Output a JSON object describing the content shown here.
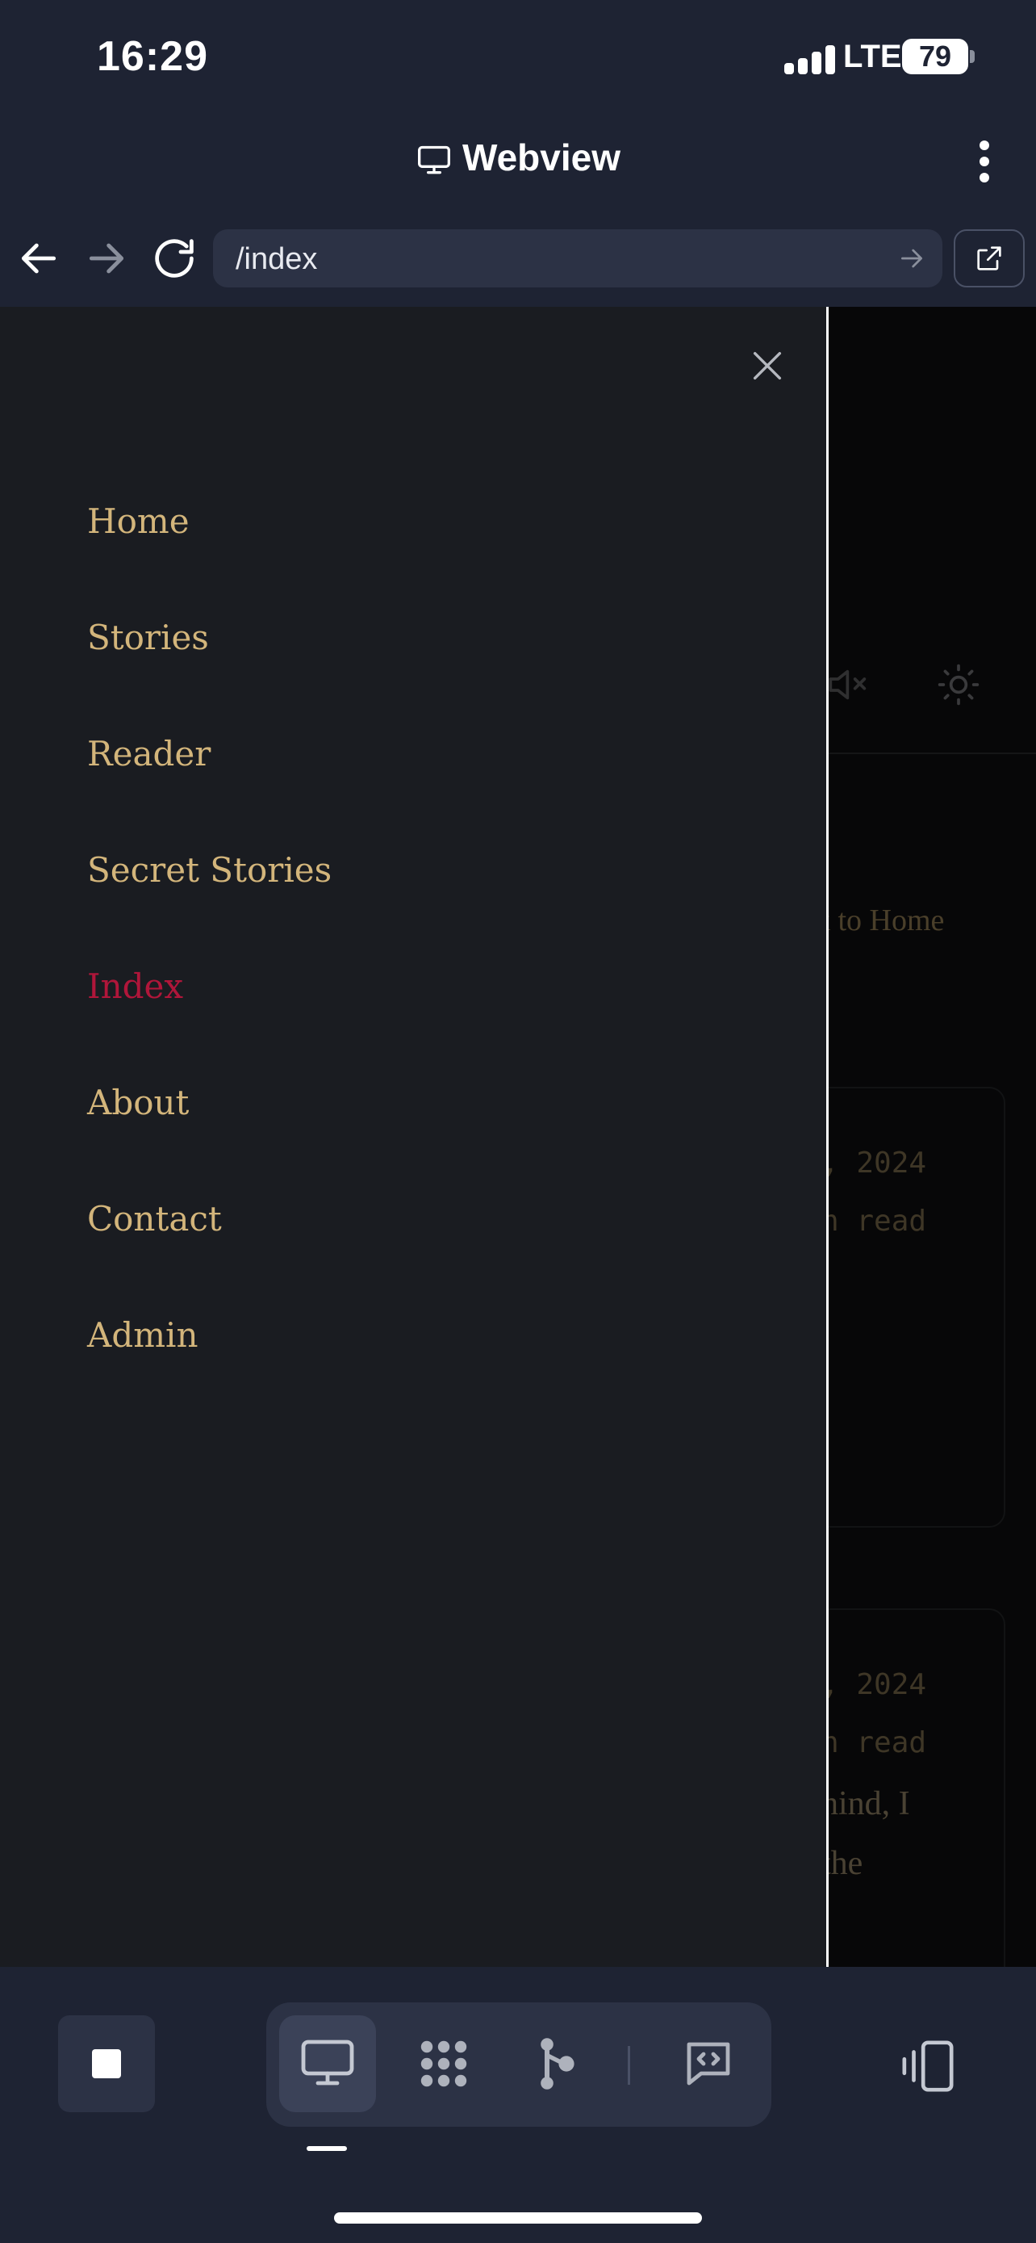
{
  "status_bar": {
    "time": "16:29",
    "network": "LTE",
    "battery": "79"
  },
  "header": {
    "title": "Webview",
    "icon": "monitor-icon",
    "menu_icon": "kebab-icon"
  },
  "url_bar": {
    "url": "/index"
  },
  "drawer": {
    "items": [
      {
        "label": "Home"
      },
      {
        "label": "Stories"
      },
      {
        "label": "Reader"
      },
      {
        "label": "Secret Stories"
      },
      {
        "label": "Index",
        "active": true
      },
      {
        "label": "About"
      },
      {
        "label": "Contact"
      },
      {
        "label": "Admin"
      }
    ],
    "active_color": "#b0163a",
    "item_color": "#d3b57b"
  },
  "background_page": {
    "back_link": "k to Home",
    "cards": [
      {
        "date": ", 2024",
        "read_time": "n read"
      },
      {
        "date": ", 2024",
        "read_time": "n read",
        "excerpt_1": "hind, I",
        "excerpt_2": "the"
      }
    ]
  },
  "toolbar": {
    "tabs": [
      "monitor-icon",
      "dots-grid-icon",
      "branch-icon",
      "code-chat-icon"
    ],
    "selected_tab": "monitor-icon"
  }
}
